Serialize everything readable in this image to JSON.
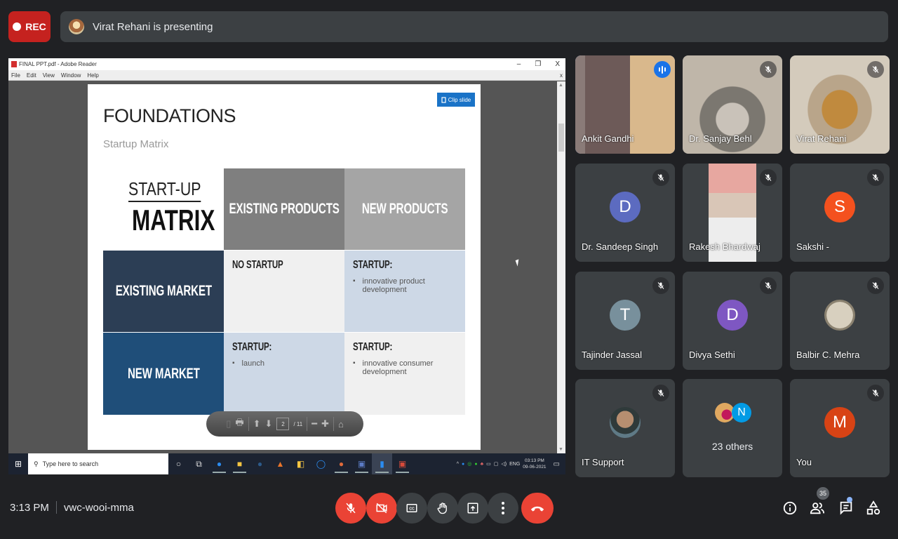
{
  "top": {
    "rec_label": "REC",
    "presenter_text": "Virat Rehani is presenting"
  },
  "window": {
    "title": "FINAL PPT.pdf - Adobe Reader",
    "minimize": "–",
    "restore": "❐",
    "close": "X",
    "menu": [
      "File",
      "Edit",
      "View",
      "Window",
      "Help"
    ],
    "menu_close": "x"
  },
  "slide": {
    "clip_label": "Clip slide",
    "title": "FOUNDATIONS",
    "subtitle": "Startup Matrix",
    "logo_line1": "START-UP",
    "logo_line2": "MATRIX",
    "col_headers": [
      "EXISTING PRODUCTS",
      "NEW PRODUCTS"
    ],
    "row_headers": [
      "EXISTING MARKET",
      "NEW MARKET"
    ],
    "cells": [
      {
        "heading": "NO STARTUP",
        "bullets": []
      },
      {
        "heading": "STARTUP:",
        "bullets": [
          "innovative product development"
        ]
      },
      {
        "heading": "STARTUP:",
        "bullets": [
          "launch"
        ]
      },
      {
        "heading": "STARTUP:",
        "bullets": [
          "innovative consumer development"
        ]
      }
    ],
    "colors": {
      "existing_products": "#7f7f7f",
      "new_products": "#a5a5a5",
      "existing_market": "#2c3e55",
      "new_market": "#1f4e79",
      "light_gray": "#f0f0f0",
      "light_blue": "#cdd8e6"
    }
  },
  "pdf_toolbar": {
    "page": "2",
    "total": "/ 11"
  },
  "taskbar": {
    "search_placeholder": "Type here to search",
    "tray_lang": "ENG",
    "time": "03:13 PM",
    "date": "09-06-2021"
  },
  "participants": [
    {
      "name": "Ankit Gandhi",
      "type": "video",
      "speaking": true
    },
    {
      "name": "Dr. Sanjay Behl",
      "type": "video",
      "muted": true
    },
    {
      "name": "Virat Rehani",
      "type": "video",
      "muted": true
    },
    {
      "name": "Dr. Sandeep Singh",
      "type": "initial",
      "initial": "D",
      "color": "#5c6bc0",
      "muted": true
    },
    {
      "name": "Rakesh Bhardwaj",
      "type": "video",
      "muted": true
    },
    {
      "name": "Sakshi -",
      "type": "initial",
      "initial": "S",
      "color": "#f4511e",
      "muted": true
    },
    {
      "name": "Tajinder Jassal",
      "type": "initial",
      "initial": "T",
      "color": "#78909c",
      "muted": true
    },
    {
      "name": "Divya Sethi",
      "type": "initial",
      "initial": "D",
      "color": "#7e57c2",
      "muted": true
    },
    {
      "name": "Balbir C. Mehra",
      "type": "photo",
      "muted": true
    },
    {
      "name": "IT Support",
      "type": "photo",
      "muted": true
    },
    {
      "name": "23 others",
      "type": "others",
      "initial": "N",
      "color": "#039be5"
    },
    {
      "name": "You",
      "type": "initial",
      "initial": "M",
      "color": "#d84315",
      "muted": true
    }
  ],
  "bottom": {
    "time": "3:13 PM",
    "meeting_code": "vwc-wooi-mma",
    "participant_count": "35"
  }
}
